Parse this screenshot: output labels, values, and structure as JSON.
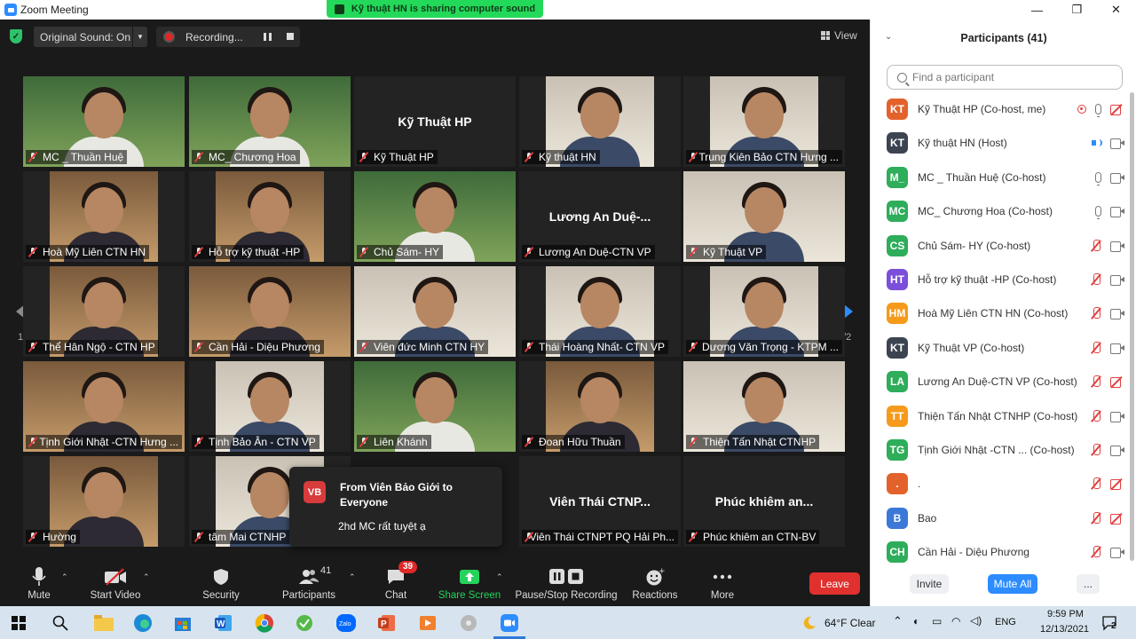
{
  "window": {
    "title": "Zoom Meeting",
    "minimize": "—",
    "maximize": "❐",
    "close": "✕"
  },
  "share_banner": "Kỹ thuật HN is sharing computer sound",
  "topbar": {
    "original_sound": "Original Sound: On",
    "recording": "Recording...",
    "view": "View"
  },
  "tiles": [
    {
      "name": "MC _ Thuần Huệ",
      "video": "green",
      "active": true
    },
    {
      "name": "MC_ Chương Hoa",
      "video": "green"
    },
    {
      "name": "Kỹ Thuật HP",
      "big": "Kỹ Thuật HP"
    },
    {
      "name": "Kỹ thuật HN",
      "video": "light"
    },
    {
      "name": "Trung Kiên Bảo CTN Hưng ...",
      "video": "light"
    },
    {
      "name": "Hoà Mỹ Liên CTN HN",
      "video": "warm"
    },
    {
      "name": "Hỗ trợ kỹ thuật -HP",
      "video": "warm"
    },
    {
      "name": "Chủ Sám- HY",
      "video": "green"
    },
    {
      "name": "Lương An Duệ-CTN VP",
      "big": "Lương An Duệ-..."
    },
    {
      "name": "Kỹ Thuật VP",
      "video": "light"
    },
    {
      "name": "Thể Hân Ngộ - CTN HP",
      "video": "warm"
    },
    {
      "name": "Cần Hải - Diệu Phương",
      "video": "warm"
    },
    {
      "name": "Viên đức Minh CTN HY",
      "video": "light"
    },
    {
      "name": "Thái Hoàng Nhất- CTN VP",
      "video": "light"
    },
    {
      "name": "Dương Văn Trọng - KTPM ...",
      "video": "light"
    },
    {
      "name": "Tịnh Giới Nhật -CTN Hưng ...",
      "video": "warm"
    },
    {
      "name": "Tịnh Bảo Ân - CTN VP",
      "video": "light"
    },
    {
      "name": "Liên Khánh",
      "video": "green"
    },
    {
      "name": "Đoan Hữu Thuần",
      "video": "warm"
    },
    {
      "name": "Thiện Tấn Nhật CTNHP",
      "video": "light"
    },
    {
      "name": "Hường",
      "video": "warm"
    },
    {
      "name": "tâm Mai CTNHP",
      "video": "light"
    },
    {
      "name": "",
      "video": "hidden"
    },
    {
      "name": "Viên Thái CTNPT PQ Hải Ph...",
      "big": "Viên Thái CTNP..."
    },
    {
      "name": "Phúc khiêm an CTN-BV",
      "big": "Phúc khiêm an..."
    }
  ],
  "page_indicator_left": "1/2",
  "page_indicator_right": "1/2",
  "chat_popup": {
    "avatar": "VB",
    "from": "From Viên Bảo Giới to Everyone",
    "message": "2hd MC rất tuyệt ạ"
  },
  "toolbar": {
    "mute": "Mute",
    "start_video": "Start Video",
    "security": "Security",
    "participants": "Participants",
    "participants_count": "41",
    "chat": "Chat",
    "chat_badge": "39",
    "share_screen": "Share Screen",
    "pause_stop": "Pause/Stop Recording",
    "reactions": "Reactions",
    "more": "More",
    "leave": "Leave"
  },
  "panel": {
    "title": "Participants (41)",
    "search_placeholder": "Find a participant",
    "invite": "Invite",
    "mute_all": "Mute All",
    "more": "...",
    "participants": [
      {
        "initials": "KT",
        "color": "#e3622c",
        "name": "Kỹ Thuật HP (Co-host, me)",
        "mic": "rec",
        "cam": "off"
      },
      {
        "initials": "KT",
        "color": "#3d4451",
        "name": "Kỹ thuật HN (Host)",
        "mic": "speaking",
        "cam": "on"
      },
      {
        "initials": "M_",
        "color": "#2ead5a",
        "name": "MC _ Thuần Huệ (Co-host)",
        "mic": "on",
        "cam": "on"
      },
      {
        "initials": "MC",
        "color": "#2ead5a",
        "name": "MC_ Chương Hoa (Co-host)",
        "mic": "on",
        "cam": "on"
      },
      {
        "initials": "CS",
        "color": "#2ead5a",
        "name": "Chủ Sám- HY (Co-host)",
        "mic": "off",
        "cam": "on"
      },
      {
        "initials": "HT",
        "color": "#7b4fd9",
        "name": "Hỗ trợ kỹ thuật -HP (Co-host)",
        "mic": "off",
        "cam": "on"
      },
      {
        "initials": "HM",
        "color": "#f59a1b",
        "name": "Hoà Mỹ Liên CTN HN (Co-host)",
        "mic": "off",
        "cam": "on"
      },
      {
        "initials": "KT",
        "color": "#3d4451",
        "name": "Kỹ Thuật VP (Co-host)",
        "mic": "off",
        "cam": "on"
      },
      {
        "initials": "LA",
        "color": "#2ead5a",
        "name": "Lương An Duệ-CTN VP (Co-host)",
        "mic": "off",
        "cam": "off"
      },
      {
        "initials": "TT",
        "color": "#f59a1b",
        "name": "Thiện Tấn Nhật CTNHP (Co-host)",
        "mic": "off",
        "cam": "on"
      },
      {
        "initials": "TG",
        "color": "#2ead5a",
        "name": "Tịnh Giới Nhật -CTN ...   (Co-host)",
        "mic": "off",
        "cam": "on"
      },
      {
        "initials": ".",
        "color": "#e3622c",
        "name": ".",
        "mic": "off",
        "cam": "off"
      },
      {
        "initials": "B",
        "color": "#3b78d8",
        "name": "Bao",
        "mic": "off",
        "cam": "off"
      },
      {
        "initials": "CH",
        "color": "#2ead5a",
        "name": "Cần Hải - Diệu Phương",
        "mic": "off",
        "cam": "on"
      }
    ]
  },
  "taskbar": {
    "weather": "64°F  Clear",
    "lang": "ENG",
    "time": "9:59 PM",
    "date": "12/13/2021",
    "notif_count": "2"
  }
}
